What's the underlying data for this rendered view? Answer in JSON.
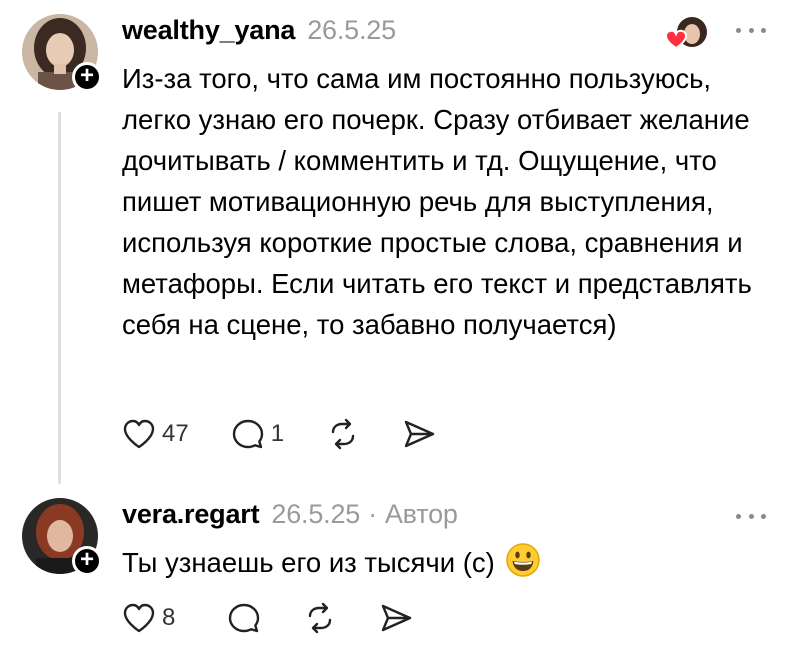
{
  "comments": [
    {
      "username": "wealthy_yana",
      "date": "26.5.25",
      "text": "Из-за того, что сама им постоянно пользуюсь, легко узнаю его почерк. Сразу отбивает желание дочитывать / комментить и тд. Ощущение, что пишет мотивационную речь для выступления, используя короткие простые слова, сравнения и метафоры. Если читать его текст и представлять себя на сцене, то забавно получается)",
      "likes": "47",
      "replies": "1",
      "liked_by_author": true
    },
    {
      "username": "vera.regart",
      "date": "26.5.25",
      "separator": "·",
      "author_label": "Автор",
      "text": "Ты узнаешь его из тысячи (с)",
      "emoji": "grinning-face",
      "likes": "8"
    }
  ],
  "colors": {
    "text": "#000000",
    "muted": "#9a9a9a",
    "heart": "#ff3040",
    "thread_line": "#dedede"
  }
}
